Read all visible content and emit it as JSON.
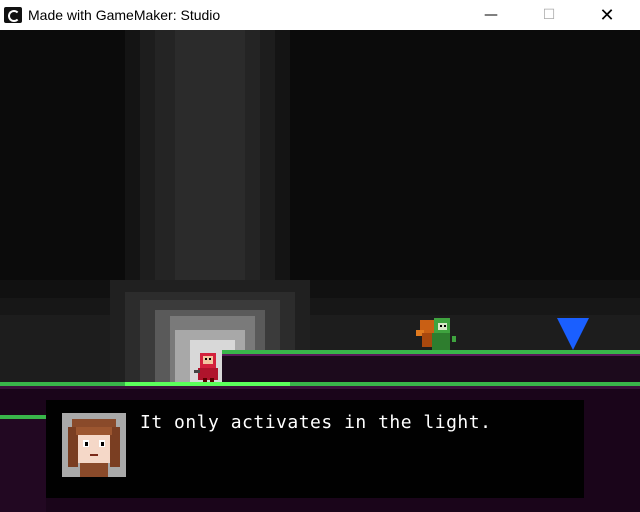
{
  "window": {
    "title": "Made with GameMaker: Studio",
    "minimize_glyph": "—",
    "maximize_glyph": "☐",
    "close_glyph": "✕"
  },
  "dialog": {
    "text": "It only activates in the light."
  },
  "colors": {
    "grass": "#2ecc40",
    "ground": "#2a0a2a",
    "pointer": "#1a5fff",
    "player_red": "#d3213c",
    "npc_green": "#3fa33f",
    "npc_orange": "#c95f14"
  },
  "icons": {
    "app": "gamemaker-icon",
    "pointer": "blue-down-triangle-icon"
  }
}
